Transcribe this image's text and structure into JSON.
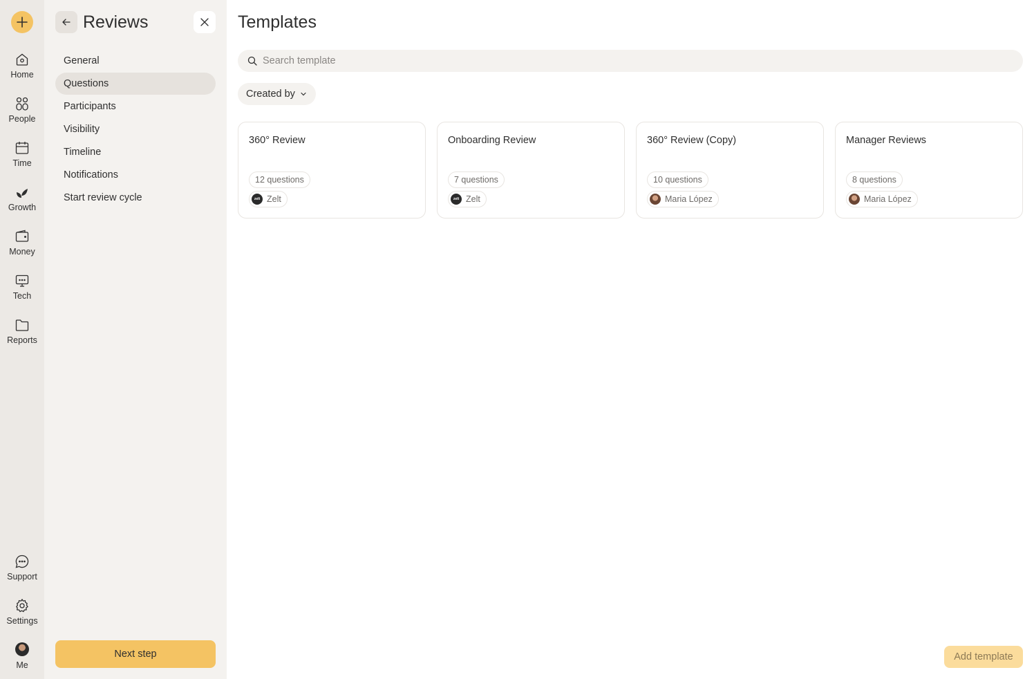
{
  "rail": {
    "add_icon": "plus-icon",
    "items": [
      {
        "label": "Home",
        "icon": "home-icon"
      },
      {
        "label": "People",
        "icon": "people-icon"
      },
      {
        "label": "Time",
        "icon": "calendar-icon"
      },
      {
        "label": "Growth",
        "icon": "leaf-icon"
      },
      {
        "label": "Money",
        "icon": "wallet-icon"
      },
      {
        "label": "Tech",
        "icon": "monitor-icon"
      },
      {
        "label": "Reports",
        "icon": "folder-icon"
      }
    ],
    "bottom_items": [
      {
        "label": "Support",
        "icon": "chat-icon"
      },
      {
        "label": "Settings",
        "icon": "gear-icon"
      },
      {
        "label": "Me",
        "icon": "avatar"
      }
    ]
  },
  "subnav": {
    "title": "Reviews",
    "items": [
      {
        "label": "General"
      },
      {
        "label": "Questions",
        "active": true
      },
      {
        "label": "Participants"
      },
      {
        "label": "Visibility"
      },
      {
        "label": "Timeline"
      },
      {
        "label": "Notifications"
      },
      {
        "label": "Start review cycle"
      }
    ],
    "next_label": "Next step"
  },
  "main": {
    "title": "Templates",
    "search_placeholder": "Search template",
    "filter_label": "Created by",
    "cards": [
      {
        "title": "360° Review",
        "questions": "12 questions",
        "owner": "Zelt"
      },
      {
        "title": "Onboarding Review",
        "questions": "7 questions",
        "owner": "Zelt"
      },
      {
        "title": "360° Review (Copy)",
        "questions": "10 questions",
        "owner": "Maria López"
      },
      {
        "title": "Manager Reviews",
        "questions": "8 questions",
        "owner": "Maria López"
      }
    ],
    "add_label": "Add template"
  },
  "colors": {
    "accent": "#f4c363",
    "rail_bg": "#ece9e5",
    "subnav_bg": "#f4f2ef",
    "active_item": "#e6e2dd",
    "add_template_bg": "#fbdc9c"
  }
}
